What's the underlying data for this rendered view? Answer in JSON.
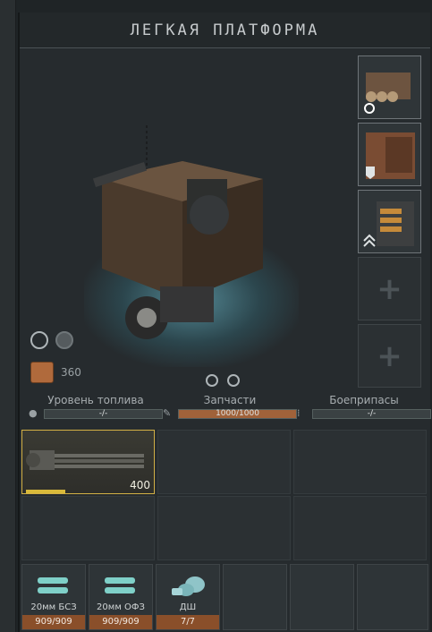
{
  "title": "ЛЕГКАЯ ПЛАТФОРМА",
  "resource": {
    "value": "360"
  },
  "stats": {
    "fuel": {
      "label": "Уровень топлива",
      "value": "-/-",
      "fill": 0
    },
    "parts": {
      "label": "Запчасти",
      "value": "1000/1000",
      "fill": 1.0
    },
    "ammo": {
      "label": "Боеприпасы",
      "value": "-/-",
      "fill": 0
    }
  },
  "weapon": {
    "value": "400"
  },
  "ammo_slots": [
    {
      "name": "20мм БСЗ",
      "count": "909/909"
    },
    {
      "name": "20мм ОФЗ",
      "count": "909/909"
    },
    {
      "name": "ДШ",
      "count": "7/7"
    }
  ],
  "colors": {
    "accent": "#d3b045",
    "bar_fill": "#a0623a",
    "glow": "#78d2e6"
  }
}
